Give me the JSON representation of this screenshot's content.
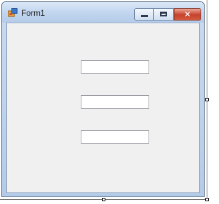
{
  "window": {
    "title": "Form1",
    "icons": {
      "app": "form-app-icon",
      "minimize": "minimize-icon",
      "maximize": "maximize-icon",
      "close": "close-icon"
    },
    "close_glyph": "✕"
  },
  "form": {
    "textboxes": [
      {
        "value": ""
      },
      {
        "value": ""
      },
      {
        "value": ""
      }
    ]
  },
  "colors": {
    "client_background": "#f0f0f0",
    "titlebar": "#c2d6ef",
    "close_button": "#c7412d"
  }
}
